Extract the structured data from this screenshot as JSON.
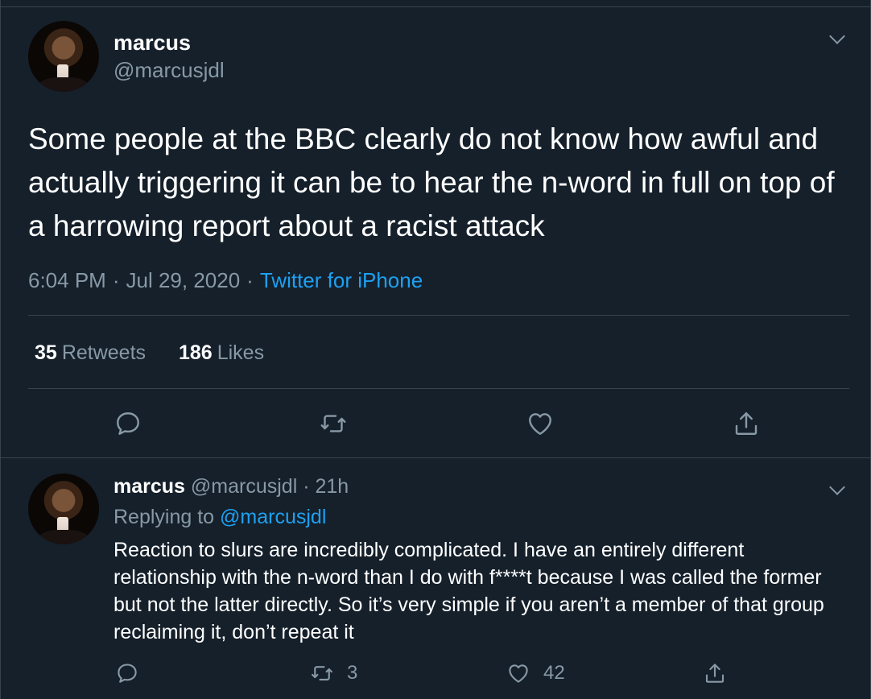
{
  "main_tweet": {
    "display_name": "marcus",
    "handle": "@marcusjdl",
    "text": "Some people at the BBC clearly do not know how awful and actually triggering it can be to hear the n-word in full on top of a harrowing report about a racist attack",
    "time": "6:04 PM",
    "date": "Jul 29, 2020",
    "separator": "·",
    "source": "Twitter for iPhone",
    "retweets_count": "35",
    "retweets_label": "Retweets",
    "likes_count": "186",
    "likes_label": "Likes"
  },
  "reply_tweet": {
    "display_name": "marcus",
    "handle": "@marcusjdl",
    "separator": "·",
    "age": "21h",
    "replying_label": "Replying to",
    "replying_handle": "@marcusjdl",
    "text": "Reaction to slurs are incredibly complicated. I have an entirely different relationship with the n-word than I do with f****t because I was called the former but not the latter directly. So it’s very simple if you aren’t a member of that group reclaiming it, don’t repeat it",
    "retweets_count": "3",
    "likes_count": "42"
  },
  "icons": {
    "reply": "reply-icon",
    "retweet": "retweet-icon",
    "like": "heart-icon",
    "share": "share-icon",
    "more": "chevron-down-icon"
  },
  "colors": {
    "background": "#15202b",
    "border": "#38444d",
    "muted_text": "#8899a6",
    "link": "#1da1f2",
    "text": "#ffffff"
  }
}
